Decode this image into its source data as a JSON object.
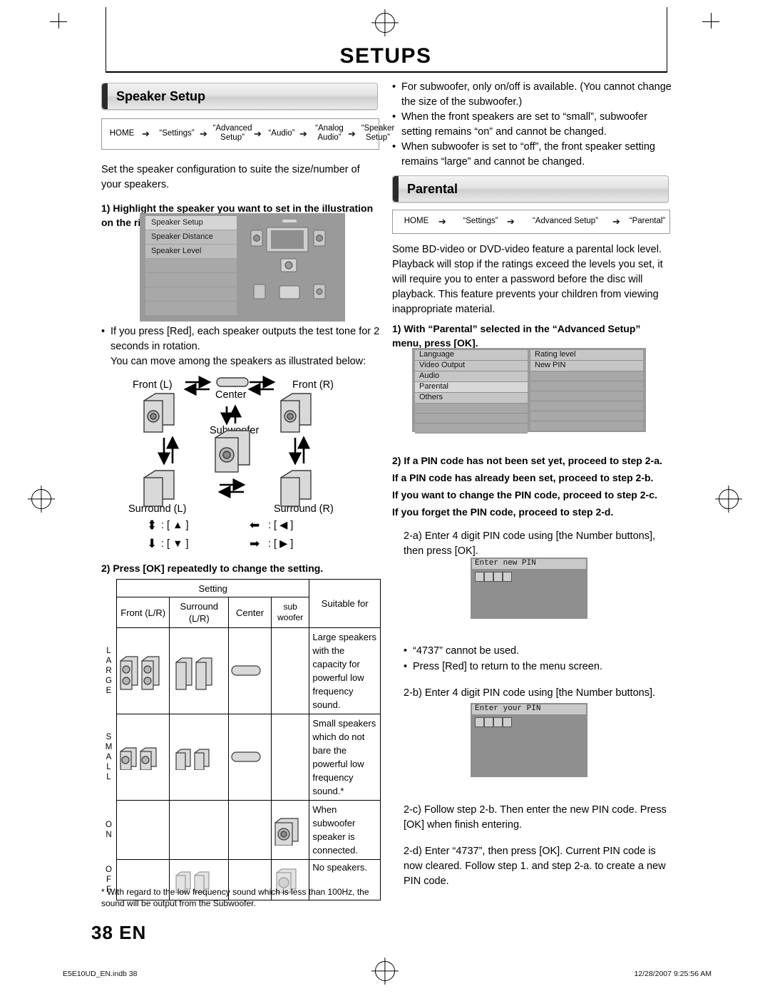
{
  "header": {
    "title": "SETUPS"
  },
  "left": {
    "section_title": "Speaker Setup",
    "breadcrumb": [
      {
        "label": "HOME"
      },
      {
        "label": "“Settings”"
      },
      {
        "label": "“Advanced Setup”"
      },
      {
        "label": "“Audio”"
      },
      {
        "label": "“Analog Audio”"
      },
      {
        "label": "“Speaker Setup”"
      }
    ],
    "intro": "Set the speaker configuration to suite the size/number of your speakers.",
    "step1": "1) Highlight the speaker you want to set in the illustration on the right.",
    "osd_menu": [
      "Speaker Setup",
      "Speaker Distance",
      "Speaker Level"
    ],
    "bullet1": "If you press [Red], each speaker outputs the test tone for 2 seconds in rotation.",
    "bullet1_cont": "You can move among the speakers as illustrated below:",
    "diagram": {
      "front_l": "Front (L)",
      "center": "Center",
      "front_r": "Front (R)",
      "subwoofer": "Subwoofer",
      "surround_l": "Surround (L)",
      "surround_r": "Surround (R)",
      "key_up": ": [ ▲ ]",
      "key_down": ": [ ▼ ]",
      "key_left": ": [ ◀ ]",
      "key_right": ": [ ▶ ]"
    },
    "step2": "2) Press [OK] repeatedly to change the setting.",
    "table": {
      "setting_header": "Setting",
      "columns": [
        "Front (L/R)",
        "Surround (L/R)",
        "Center",
        "sub woofer",
        "Suitable for"
      ],
      "rows": [
        {
          "label": "LARGE",
          "suitable": "Large speakers with the capacity for powerful low frequency sound."
        },
        {
          "label": "SMALL",
          "suitable": "Small speakers which do not bare the powerful low frequency sound.*"
        },
        {
          "label": "ON",
          "suitable": "When subwoofer speaker is connected."
        },
        {
          "label": "OFF",
          "suitable": "No speakers."
        }
      ]
    },
    "footnote": "* With regard to the low frequency sound which is less than 100Hz, the sound will be output from the Subwoofer."
  },
  "right": {
    "bullets": [
      "For subwoofer, only on/off is available. (You cannot change the size of the subwoofer.)",
      "When the front speakers are set to “small”, subwoofer setting remains “on” and cannot be changed.",
      "When subwoofer is set to “off”, the front speaker setting remains “large” and cannot be changed."
    ],
    "section_title": "Parental",
    "breadcrumb": [
      {
        "label": "HOME"
      },
      {
        "label": "“Settings”"
      },
      {
        "label": "“Advanced Setup”"
      },
      {
        "label": "“Parental”"
      }
    ],
    "intro": "Some BD-video or DVD-video feature a parental lock level. Playback will stop if the ratings exceed the levels you set, it will require you to enter a password before the disc will playback. This feature prevents your children from viewing inappropriate material.",
    "step1": "1) With “Parental” selected in the “Advanced Setup” menu, press [OK].",
    "osd_left": [
      "Language",
      "Video Output",
      "Audio",
      "Parental",
      "Others"
    ],
    "osd_right": [
      "Rating level",
      "New PIN"
    ],
    "step2": "2) If a PIN code has not been set yet, proceed to step 2-a.",
    "step2_lines": [
      "If a PIN code has already been set, proceed to step 2-b.",
      "If you want to change the PIN code, proceed to step 2-c.",
      "If you forget the PIN code, proceed to step 2-d."
    ],
    "step2a": "2-a) Enter 4 digit PIN code using [the Number buttons], then press [OK].",
    "osd_new_pin_title": "Enter new PIN",
    "note_4737": "“4737” cannot be used.",
    "note_red": "Press [Red] to return to the menu screen.",
    "step2b": "2-b) Enter 4 digit PIN code using [the Number buttons].",
    "osd_your_pin_title": "Enter your PIN",
    "step2c": "2-c) Follow step 2-b. Then enter the new PIN code. Press [OK] when finish entering.",
    "step2d": "2-d) Enter “4737”, then press [OK]. Current PIN code is now cleared. Follow step 1. and step 2-a. to create a new PIN code."
  },
  "footer": {
    "page": "38  EN",
    "left": "E5E10UD_EN.indb   38",
    "right": "12/28/2007   9:25:56 AM"
  }
}
